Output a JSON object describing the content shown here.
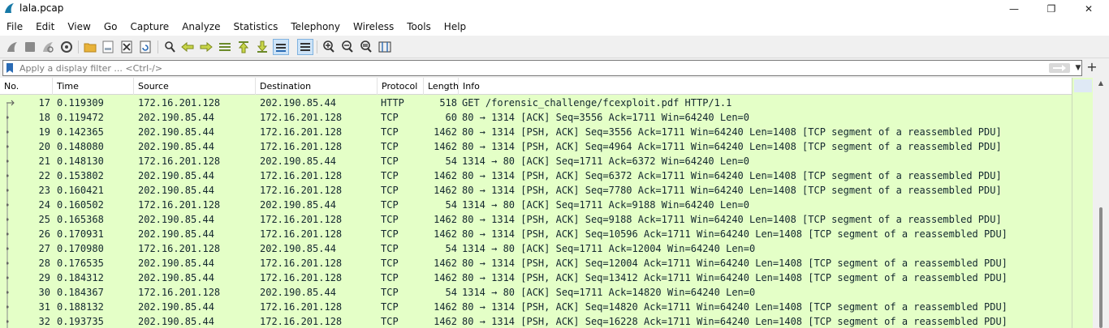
{
  "window": {
    "title": "lala.pcap",
    "min_glyph": "—",
    "max_glyph": "❐",
    "close_glyph": "✕"
  },
  "menu": [
    "File",
    "Edit",
    "View",
    "Go",
    "Capture",
    "Analyze",
    "Statistics",
    "Telephony",
    "Wireless",
    "Tools",
    "Help"
  ],
  "toolbar_icons": [
    "start-capture-icon",
    "stop-capture-icon",
    "restart-capture-icon",
    "capture-options-icon",
    "open-file-icon",
    "save-file-icon",
    "close-file-icon",
    "reload-file-icon",
    "find-packet-icon",
    "go-back-icon",
    "go-forward-icon",
    "go-to-packet-icon",
    "first-packet-icon",
    "last-packet-icon",
    "auto-scroll-icon",
    "colorize-icon",
    "zoom-in-icon",
    "zoom-out-icon",
    "normal-size-icon",
    "resize-columns-icon"
  ],
  "filter": {
    "placeholder": "Apply a display filter ... <Ctrl-/>",
    "value": ""
  },
  "colors": {
    "row_bg": "#e4ffc7",
    "row_text": "#12272e"
  },
  "columns": [
    "No.",
    "Time",
    "Source",
    "Destination",
    "Protocol",
    "Length",
    "Info"
  ],
  "packets": [
    {
      "no": "17",
      "time": "0.119309",
      "src": "172.16.201.128",
      "dst": "202.190.85.44",
      "proto": "HTTP",
      "len": "518",
      "info": "GET /forensic_challenge/fcexploit.pdf HTTP/1.1"
    },
    {
      "no": "18",
      "time": "0.119472",
      "src": "202.190.85.44",
      "dst": "172.16.201.128",
      "proto": "TCP",
      "len": "60",
      "info": "80 → 1314 [ACK] Seq=3556 Ack=1711 Win=64240 Len=0"
    },
    {
      "no": "19",
      "time": "0.142365",
      "src": "202.190.85.44",
      "dst": "172.16.201.128",
      "proto": "TCP",
      "len": "1462",
      "info": "80 → 1314 [PSH, ACK] Seq=3556 Ack=1711 Win=64240 Len=1408 [TCP segment of a reassembled PDU]"
    },
    {
      "no": "20",
      "time": "0.148080",
      "src": "202.190.85.44",
      "dst": "172.16.201.128",
      "proto": "TCP",
      "len": "1462",
      "info": "80 → 1314 [PSH, ACK] Seq=4964 Ack=1711 Win=64240 Len=1408 [TCP segment of a reassembled PDU]"
    },
    {
      "no": "21",
      "time": "0.148130",
      "src": "172.16.201.128",
      "dst": "202.190.85.44",
      "proto": "TCP",
      "len": "54",
      "info": "1314 → 80 [ACK] Seq=1711 Ack=6372 Win=64240 Len=0"
    },
    {
      "no": "22",
      "time": "0.153802",
      "src": "202.190.85.44",
      "dst": "172.16.201.128",
      "proto": "TCP",
      "len": "1462",
      "info": "80 → 1314 [PSH, ACK] Seq=6372 Ack=1711 Win=64240 Len=1408 [TCP segment of a reassembled PDU]"
    },
    {
      "no": "23",
      "time": "0.160421",
      "src": "202.190.85.44",
      "dst": "172.16.201.128",
      "proto": "TCP",
      "len": "1462",
      "info": "80 → 1314 [PSH, ACK] Seq=7780 Ack=1711 Win=64240 Len=1408 [TCP segment of a reassembled PDU]"
    },
    {
      "no": "24",
      "time": "0.160502",
      "src": "172.16.201.128",
      "dst": "202.190.85.44",
      "proto": "TCP",
      "len": "54",
      "info": "1314 → 80 [ACK] Seq=1711 Ack=9188 Win=64240 Len=0"
    },
    {
      "no": "25",
      "time": "0.165368",
      "src": "202.190.85.44",
      "dst": "172.16.201.128",
      "proto": "TCP",
      "len": "1462",
      "info": "80 → 1314 [PSH, ACK] Seq=9188 Ack=1711 Win=64240 Len=1408 [TCP segment of a reassembled PDU]"
    },
    {
      "no": "26",
      "time": "0.170931",
      "src": "202.190.85.44",
      "dst": "172.16.201.128",
      "proto": "TCP",
      "len": "1462",
      "info": "80 → 1314 [PSH, ACK] Seq=10596 Ack=1711 Win=64240 Len=1408 [TCP segment of a reassembled PDU]"
    },
    {
      "no": "27",
      "time": "0.170980",
      "src": "172.16.201.128",
      "dst": "202.190.85.44",
      "proto": "TCP",
      "len": "54",
      "info": "1314 → 80 [ACK] Seq=1711 Ack=12004 Win=64240 Len=0"
    },
    {
      "no": "28",
      "time": "0.176535",
      "src": "202.190.85.44",
      "dst": "172.16.201.128",
      "proto": "TCP",
      "len": "1462",
      "info": "80 → 1314 [PSH, ACK] Seq=12004 Ack=1711 Win=64240 Len=1408 [TCP segment of a reassembled PDU]"
    },
    {
      "no": "29",
      "time": "0.184312",
      "src": "202.190.85.44",
      "dst": "172.16.201.128",
      "proto": "TCP",
      "len": "1462",
      "info": "80 → 1314 [PSH, ACK] Seq=13412 Ack=1711 Win=64240 Len=1408 [TCP segment of a reassembled PDU]"
    },
    {
      "no": "30",
      "time": "0.184367",
      "src": "172.16.201.128",
      "dst": "202.190.85.44",
      "proto": "TCP",
      "len": "54",
      "info": "1314 → 80 [ACK] Seq=1711 Ack=14820 Win=64240 Len=0"
    },
    {
      "no": "31",
      "time": "0.188132",
      "src": "202.190.85.44",
      "dst": "172.16.201.128",
      "proto": "TCP",
      "len": "1462",
      "info": "80 → 1314 [PSH, ACK] Seq=14820 Ack=1711 Win=64240 Len=1408 [TCP segment of a reassembled PDU]"
    },
    {
      "no": "32",
      "time": "0.193735",
      "src": "202.190.85.44",
      "dst": "172.16.201.128",
      "proto": "TCP",
      "len": "1462",
      "info": "80 → 1314 [PSH, ACK] Seq=16228 Ack=1711 Win=64240 Len=1408 [TCP segment of a reassembled PDU]"
    }
  ]
}
